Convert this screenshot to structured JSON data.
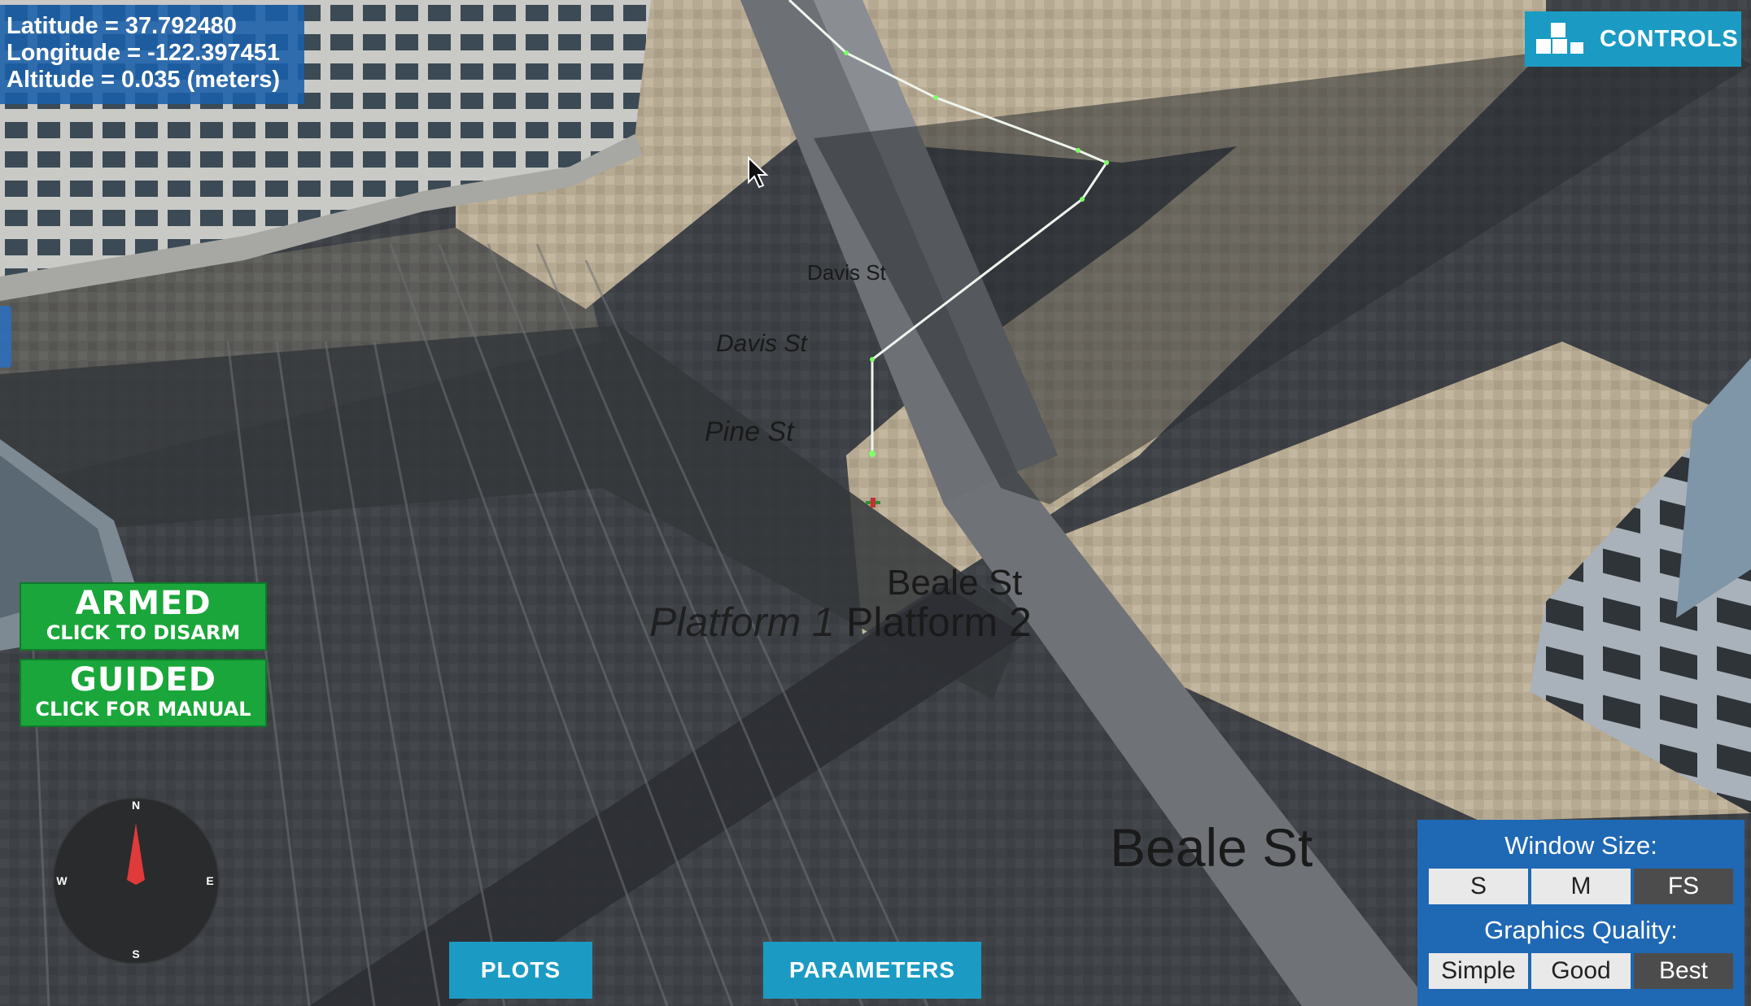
{
  "hud": {
    "latitude": "Latitude = 37.792480",
    "longitude": "Longitude = -122.397451",
    "altitude": "Altitude = 0.035 (meters)"
  },
  "controls": {
    "label": "CONTROLS",
    "icon": "blocks-icon"
  },
  "mode_buttons": {
    "armed": {
      "title": "ARMED",
      "subtitle": "CLICK TO DISARM"
    },
    "guided": {
      "title": "GUIDED",
      "subtitle": "CLICK FOR MANUAL"
    }
  },
  "bottom_buttons": {
    "plots": "PLOTS",
    "parameters": "PARAMETERS"
  },
  "settings_panel": {
    "window_size_label": "Window Size:",
    "window_sizes": [
      "S",
      "M",
      "FS"
    ],
    "selected_window_size": "FS",
    "graphics_quality_label": "Graphics Quality:",
    "graphics_qualities": [
      "Simple",
      "Good",
      "Best"
    ],
    "selected_graphics_quality": "Best"
  },
  "compass": {
    "north": "N",
    "south": "S",
    "east": "E",
    "west": "W"
  },
  "street_labels": {
    "davis_1": "Davis St",
    "davis_2": "Davis St",
    "pine": "Pine St",
    "beale_1": "Beale St",
    "platform_1": "Platform 1",
    "platform_2": "Platform 2",
    "beale_2": "Beale St"
  },
  "colors": {
    "hud_bg": "#195faa",
    "controls_bg": "#1b9bc3",
    "mode_green": "#1aa63a",
    "panel_bg": "#1f68b4",
    "path_line": "#e8f0e8",
    "waypoint": "#7dff6a"
  }
}
